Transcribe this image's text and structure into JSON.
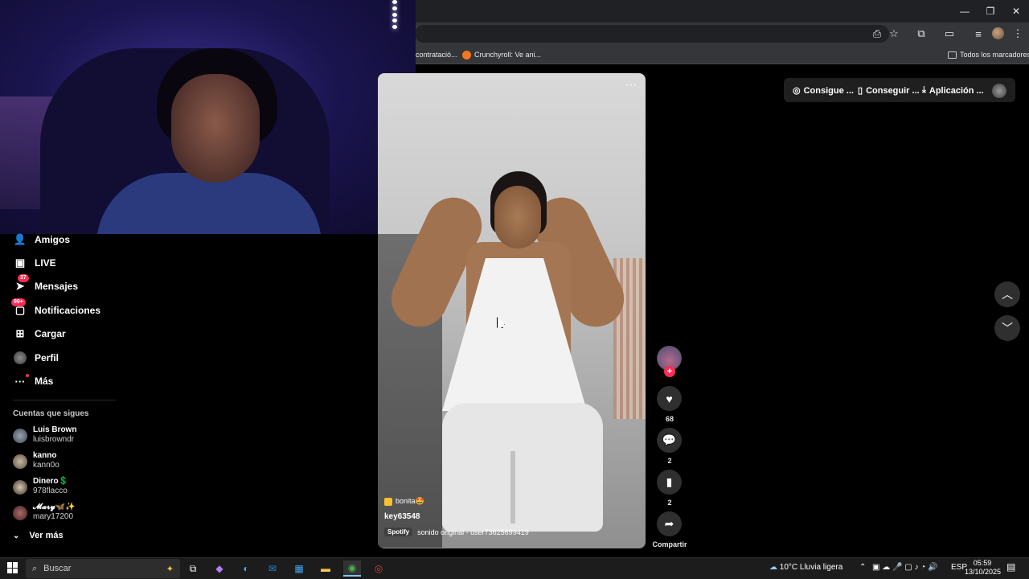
{
  "bookmarks": {
    "item1": "contratació...",
    "item2": "Crunchyroll: Ve ani...",
    "all": "Todos los marcadores"
  },
  "sidebar": {
    "items": [
      {
        "label": "Amigos",
        "icon": "friends-icon"
      },
      {
        "label": "LIVE",
        "icon": "live-icon"
      },
      {
        "label": "Mensajes",
        "icon": "messages-icon",
        "badge": "37"
      },
      {
        "label": "Notificaciones",
        "icon": "notifications-icon",
        "badge": "99+"
      },
      {
        "label": "Cargar",
        "icon": "upload-icon"
      },
      {
        "label": "Perfil",
        "icon": "profile-icon"
      },
      {
        "label": "Más",
        "icon": "more-icon"
      }
    ],
    "following_title": "Cuentas que sigues",
    "accounts": [
      {
        "name": "Luis Brown",
        "handle": "luisbrowndr"
      },
      {
        "name": "kanno",
        "handle": "kann0o"
      },
      {
        "name": "Dinero💲",
        "handle": "978flacco"
      },
      {
        "name": "𝓜𝓪𝓻𝔂🦋✨",
        "handle": "mary17200"
      }
    ],
    "see_more": "Ver más"
  },
  "header": {
    "coins": "Consigue ...",
    "get": "Conseguir ...",
    "app": "Aplicación ..."
  },
  "video": {
    "menu": "⋯",
    "tag": "bonita🤩",
    "username": "key63548",
    "spotify": "Spotify",
    "sound": "sonido original - user73625699419"
  },
  "actions": {
    "likes": "68",
    "comments": "2",
    "saves": "2",
    "share": "Compartir"
  },
  "taskbar": {
    "search_placeholder": "Buscar",
    "weather": "10°C  Lluvia ligera",
    "lang": "ESP",
    "time": "05:59",
    "date": "13/10/2025"
  },
  "colors": {
    "accent": "#fe2c55",
    "background": "#000000",
    "chrome": "#35363a"
  }
}
